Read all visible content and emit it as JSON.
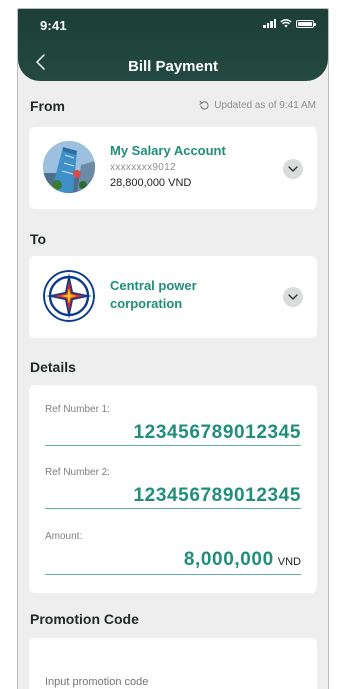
{
  "status": {
    "time": "9:41"
  },
  "header": {
    "title": "Bill Payment"
  },
  "from": {
    "label": "From",
    "updated": "Updated as of 9:41 AM",
    "account_name": "My Salary Account",
    "account_number": "xxxxxxxx9012",
    "balance": "28,800,000 VND"
  },
  "to": {
    "label": "To",
    "payee_line1": "Central power",
    "payee_line2": "corporation"
  },
  "details": {
    "label": "Details",
    "ref1_label": "Ref Number 1:",
    "ref1_value": "123456789012345",
    "ref2_label": "Ref Number 2:",
    "ref2_value": "123456789012345",
    "amount_label": "Amount:",
    "amount_value": "8,000,000",
    "amount_unit": "VND"
  },
  "promotion": {
    "label": "Promotion Code",
    "placeholder": "Input promotion code"
  },
  "colors": {
    "header_bg": "#1c3f36",
    "accent": "#1f8f7a",
    "page_bg": "#eeeeee"
  },
  "icons": {
    "back": "chevron-left-icon",
    "refresh": "refresh-icon",
    "dropdown": "chevron-down-icon",
    "signal": "signal-icon",
    "wifi": "wifi-icon",
    "battery": "battery-icon"
  }
}
